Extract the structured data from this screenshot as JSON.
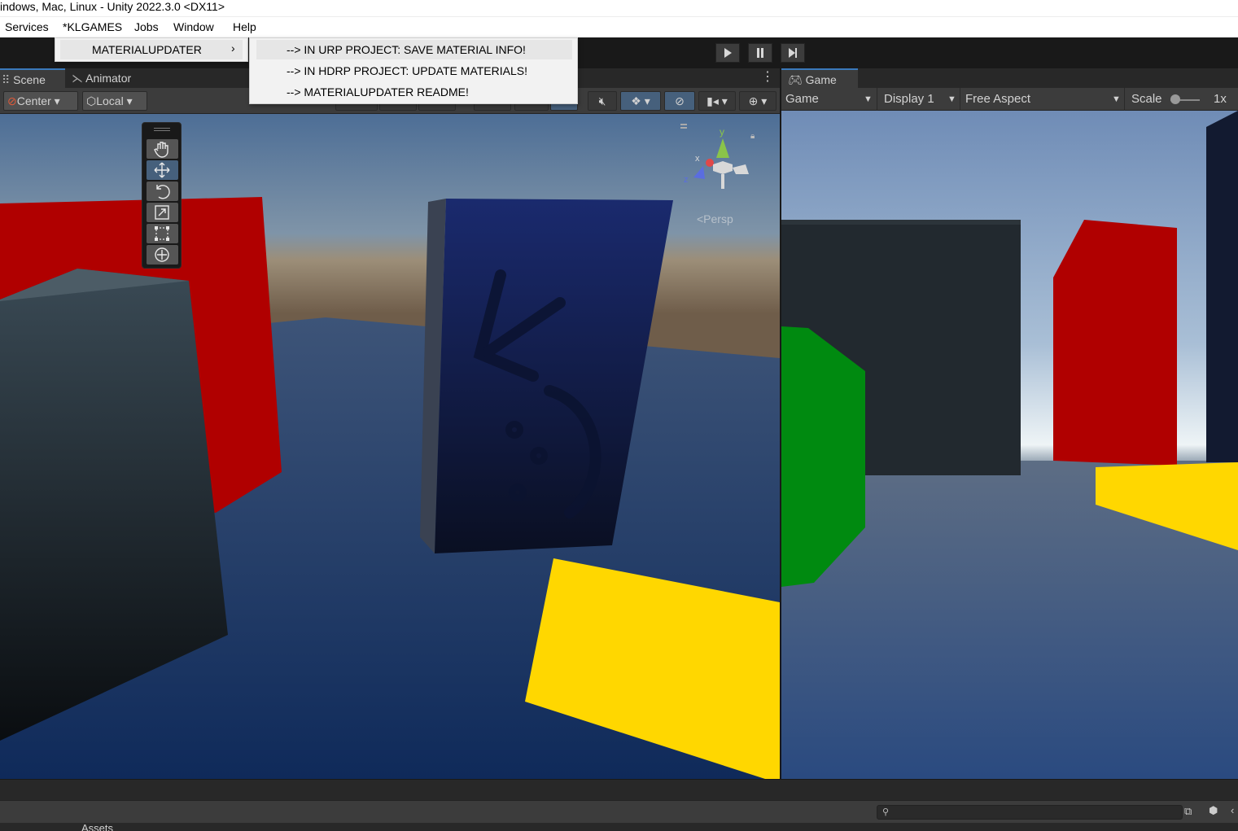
{
  "window": {
    "title": "indows, Mac, Linux - Unity 2022.3.0 <DX11>"
  },
  "menubar": {
    "items": [
      "Services",
      "*KLGAMES",
      "Jobs",
      "Window",
      "Help"
    ]
  },
  "dropdown": {
    "main_item": "MATERIALUPDATER",
    "submenu": [
      "--> IN URP PROJECT: SAVE MATERIAL INFO!",
      "--> IN HDRP PROJECT: UPDATE MATERIALS!",
      "--> MATERIALUPDATER README!"
    ]
  },
  "scene": {
    "tabs": [
      "Scene",
      "Animator"
    ],
    "pivot_mode": "Center",
    "pivot_rotation": "Local",
    "projection_label": "<Persp",
    "gizmo_axes": {
      "x": "x",
      "y": "y",
      "z": "z"
    }
  },
  "game": {
    "tab": "Game",
    "view_select": "Game",
    "display": "Display 1",
    "aspect": "Free Aspect",
    "scale_label": "Scale",
    "scale_value": "1x"
  },
  "bottom": {
    "assets_tab": "Assets"
  },
  "colors": {
    "accent": "#3a79bb",
    "red_cube": "#b00000",
    "yellow_plane": "#ffd700",
    "green_cube": "#008a10",
    "navy_cube": "#14205a"
  }
}
